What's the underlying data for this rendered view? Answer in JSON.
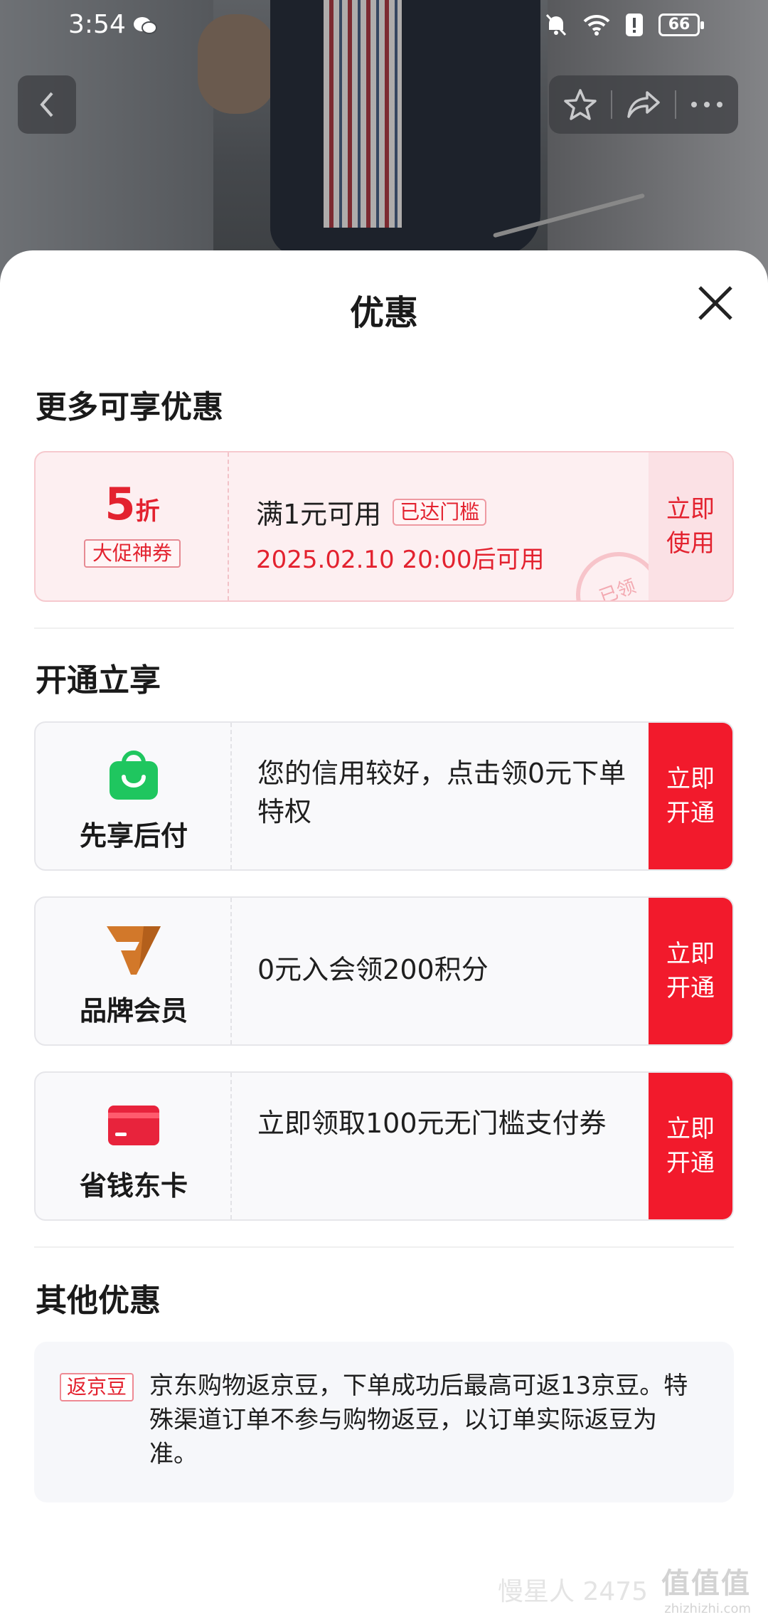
{
  "status_bar": {
    "time": "3:54",
    "battery": "66"
  },
  "sheet": {
    "title": "优惠"
  },
  "sections": {
    "more": "更多可享优惠",
    "open": "开通立享",
    "other": "其他优惠"
  },
  "coupon": {
    "discount_value": "5",
    "discount_unit": "折",
    "tag": "大促神券",
    "condition": "满1元可用",
    "threshold_badge": "已达门槛",
    "date": "2025.02.10 20:00后可用",
    "action": "立即使用",
    "stamp": "已领"
  },
  "services": [
    {
      "name": "先享后付",
      "desc": "您的信用较好，点击领0元下单特权",
      "action": "立即开通",
      "icon": "shopping-bag-icon",
      "color": "#1fc65f"
    },
    {
      "name": "品牌会员",
      "desc": "0元入会领200积分",
      "action": "立即开通",
      "icon": "brand-v-icon",
      "color": "#d2782a"
    },
    {
      "name": "省钱东卡",
      "desc": "立即领取100元无门槛支付券",
      "action": "立即开通",
      "icon": "card-icon",
      "color": "#e8233c"
    }
  ],
  "other": {
    "chip": "返京豆",
    "text": "京东购物返京豆，下单成功后最高可返13京豆。特殊渠道订单不参与购物返豆，以订单实际返豆为准。"
  },
  "watermark": {
    "main": "值值值",
    "sub": "zhizhizhi.com",
    "left": "慢星人 2475"
  },
  "colors": {
    "accent": "#f21a2c",
    "coupon_bg": "#fdeff1"
  }
}
